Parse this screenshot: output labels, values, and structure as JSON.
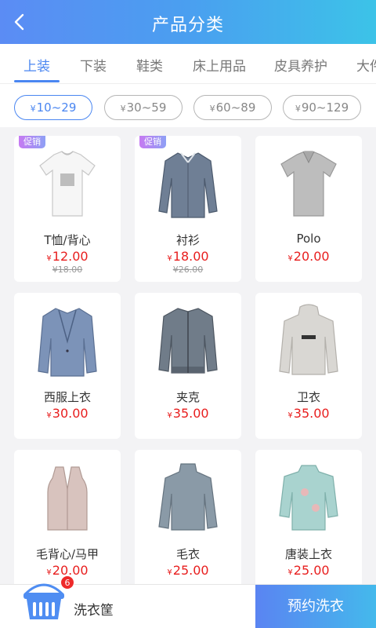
{
  "header": {
    "title": "产品分类"
  },
  "tabs": [
    {
      "label": "上装",
      "active": true
    },
    {
      "label": "下装"
    },
    {
      "label": "鞋类"
    },
    {
      "label": "床上用品"
    },
    {
      "label": "皮具养护"
    },
    {
      "label": "大件"
    }
  ],
  "price_filters": [
    {
      "yen": "¥",
      "range": "10~29",
      "active": true
    },
    {
      "yen": "¥",
      "range": "30~59"
    },
    {
      "yen": "¥",
      "range": "60~89"
    },
    {
      "yen": "¥",
      "range": "90~129"
    }
  ],
  "products": [
    {
      "name": "T恤/背心",
      "yen": "¥",
      "price": "12.00",
      "old_price": "¥18.00",
      "promo": "促销",
      "icon": "tshirt-icon"
    },
    {
      "name": "衬衫",
      "yen": "¥",
      "price": "18.00",
      "old_price": "¥26.00",
      "promo": "促销",
      "icon": "shirt-icon"
    },
    {
      "name": "Polo",
      "yen": "¥",
      "price": "20.00",
      "icon": "polo-shirt-icon"
    },
    {
      "name": "西服上衣",
      "yen": "¥",
      "price": "30.00",
      "icon": "suit-jacket-icon"
    },
    {
      "name": "夹克",
      "yen": "¥",
      "price": "35.00",
      "icon": "jacket-icon"
    },
    {
      "name": "卫衣",
      "yen": "¥",
      "price": "35.00",
      "icon": "hoodie-icon"
    },
    {
      "name": "毛背心/马甲",
      "yen": "¥",
      "price": "20.00",
      "icon": "vest-icon"
    },
    {
      "name": "毛衣",
      "yen": "¥",
      "price": "25.00",
      "icon": "sweater-icon"
    },
    {
      "name": "唐装上衣",
      "yen": "¥",
      "price": "25.00",
      "icon": "tang-jacket-icon"
    }
  ],
  "basket": {
    "label": "洗衣筐",
    "count": "6"
  },
  "book_button": {
    "label": "预约洗衣"
  },
  "colors": {
    "accent": "#4a86f1",
    "price": "#e81e1e",
    "header_start": "#5b8cf4",
    "header_end": "#3cc3e8"
  }
}
